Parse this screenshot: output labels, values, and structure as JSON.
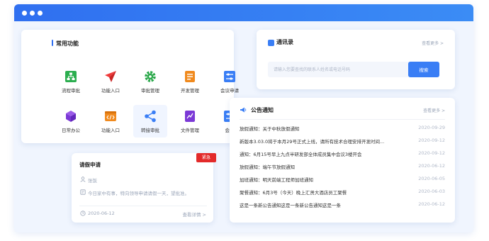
{
  "common": {
    "title": "常用功能",
    "items": [
      {
        "label": "流程审批",
        "icon": "flowchart-icon",
        "color": "#2cae4f"
      },
      {
        "label": "功能入口",
        "icon": "paper-plane-icon",
        "color": "#f03a3a"
      },
      {
        "label": "审批管理",
        "icon": "gear-icon",
        "color": "#2aa84a"
      },
      {
        "label": "开发管理",
        "icon": "document-icon",
        "color": "#f08a1e"
      },
      {
        "label": "会议申请",
        "icon": "sliders-icon",
        "color": "#3a7ef5"
      },
      {
        "label": "日常办公",
        "icon": "cube-icon",
        "color": "#7b39d6"
      },
      {
        "label": "功能入口",
        "icon": "code-window-icon",
        "color": "#f08a1e"
      },
      {
        "label": "转接审批",
        "icon": "share-icon",
        "color": "#3a7ef5"
      },
      {
        "label": "文件管理",
        "icon": "file-chart-icon",
        "color": "#7b39d6"
      },
      {
        "label": "会议",
        "icon": "sliders-icon",
        "color": "#3a7ef5"
      }
    ]
  },
  "directory": {
    "title": "通讯录",
    "more": "查看更多 >",
    "search_placeholder": "请输入您要查找的联系人姓名或电话号码",
    "search_button": "搜索"
  },
  "announcements": {
    "title": "公告通知",
    "more": "查看更多 >",
    "items": [
      {
        "text": "放假通知：关于中秋放假通知",
        "date": "2020-09-29"
      },
      {
        "text": "新版本3.03.0将于本月29号正式上线，请所有技术合理安排开发时间...",
        "date": "2020-09-12"
      },
      {
        "text": "通知：6月15号早上九点半研发部全体成员集中会议3楼开会",
        "date": "2020-09-12"
      },
      {
        "text": "放假通知：端午节放假通知",
        "date": "2020-06-12"
      },
      {
        "text": "加班通知：明天前端工程师加班通知",
        "date": "2020-06-05"
      },
      {
        "text": "聚餐通知：6月3号（今天）晚上汇贤大酒店员工聚餐",
        "date": "2020-06-03"
      },
      {
        "text": "这是一条新公告通知这是一条新公告通知这是一条",
        "date": "2020-06-12"
      }
    ]
  },
  "leave": {
    "title": "请假申请",
    "badge": "紧急",
    "applicant": "张饭",
    "reason": "今日家中有事，特向领导申请请假一天，望批准。",
    "date": "2020-06-12",
    "details": "查看详情 >"
  },
  "colors": {
    "accent": "#2f6ff0",
    "titlebar": "#3b8cf5",
    "badge": "#e32a2a"
  }
}
